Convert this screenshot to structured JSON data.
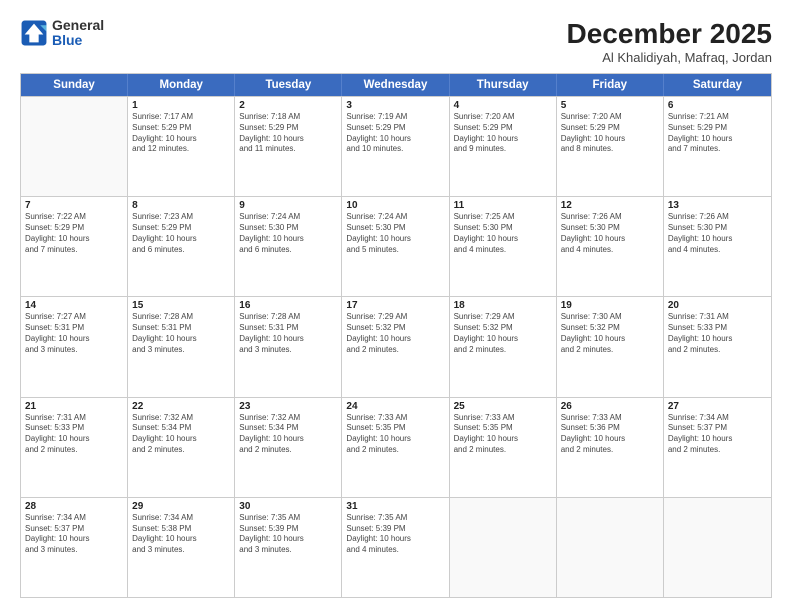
{
  "logo": {
    "line1": "General",
    "line2": "Blue"
  },
  "title": "December 2025",
  "location": "Al Khalidiyah, Mafraq, Jordan",
  "header_days": [
    "Sunday",
    "Monday",
    "Tuesday",
    "Wednesday",
    "Thursday",
    "Friday",
    "Saturday"
  ],
  "weeks": [
    [
      {
        "day": "",
        "info": ""
      },
      {
        "day": "1",
        "info": "Sunrise: 7:17 AM\nSunset: 5:29 PM\nDaylight: 10 hours\nand 12 minutes."
      },
      {
        "day": "2",
        "info": "Sunrise: 7:18 AM\nSunset: 5:29 PM\nDaylight: 10 hours\nand 11 minutes."
      },
      {
        "day": "3",
        "info": "Sunrise: 7:19 AM\nSunset: 5:29 PM\nDaylight: 10 hours\nand 10 minutes."
      },
      {
        "day": "4",
        "info": "Sunrise: 7:20 AM\nSunset: 5:29 PM\nDaylight: 10 hours\nand 9 minutes."
      },
      {
        "day": "5",
        "info": "Sunrise: 7:20 AM\nSunset: 5:29 PM\nDaylight: 10 hours\nand 8 minutes."
      },
      {
        "day": "6",
        "info": "Sunrise: 7:21 AM\nSunset: 5:29 PM\nDaylight: 10 hours\nand 7 minutes."
      }
    ],
    [
      {
        "day": "7",
        "info": "Sunrise: 7:22 AM\nSunset: 5:29 PM\nDaylight: 10 hours\nand 7 minutes."
      },
      {
        "day": "8",
        "info": "Sunrise: 7:23 AM\nSunset: 5:29 PM\nDaylight: 10 hours\nand 6 minutes."
      },
      {
        "day": "9",
        "info": "Sunrise: 7:24 AM\nSunset: 5:30 PM\nDaylight: 10 hours\nand 6 minutes."
      },
      {
        "day": "10",
        "info": "Sunrise: 7:24 AM\nSunset: 5:30 PM\nDaylight: 10 hours\nand 5 minutes."
      },
      {
        "day": "11",
        "info": "Sunrise: 7:25 AM\nSunset: 5:30 PM\nDaylight: 10 hours\nand 4 minutes."
      },
      {
        "day": "12",
        "info": "Sunrise: 7:26 AM\nSunset: 5:30 PM\nDaylight: 10 hours\nand 4 minutes."
      },
      {
        "day": "13",
        "info": "Sunrise: 7:26 AM\nSunset: 5:30 PM\nDaylight: 10 hours\nand 4 minutes."
      }
    ],
    [
      {
        "day": "14",
        "info": "Sunrise: 7:27 AM\nSunset: 5:31 PM\nDaylight: 10 hours\nand 3 minutes."
      },
      {
        "day": "15",
        "info": "Sunrise: 7:28 AM\nSunset: 5:31 PM\nDaylight: 10 hours\nand 3 minutes."
      },
      {
        "day": "16",
        "info": "Sunrise: 7:28 AM\nSunset: 5:31 PM\nDaylight: 10 hours\nand 3 minutes."
      },
      {
        "day": "17",
        "info": "Sunrise: 7:29 AM\nSunset: 5:32 PM\nDaylight: 10 hours\nand 2 minutes."
      },
      {
        "day": "18",
        "info": "Sunrise: 7:29 AM\nSunset: 5:32 PM\nDaylight: 10 hours\nand 2 minutes."
      },
      {
        "day": "19",
        "info": "Sunrise: 7:30 AM\nSunset: 5:32 PM\nDaylight: 10 hours\nand 2 minutes."
      },
      {
        "day": "20",
        "info": "Sunrise: 7:31 AM\nSunset: 5:33 PM\nDaylight: 10 hours\nand 2 minutes."
      }
    ],
    [
      {
        "day": "21",
        "info": "Sunrise: 7:31 AM\nSunset: 5:33 PM\nDaylight: 10 hours\nand 2 minutes."
      },
      {
        "day": "22",
        "info": "Sunrise: 7:32 AM\nSunset: 5:34 PM\nDaylight: 10 hours\nand 2 minutes."
      },
      {
        "day": "23",
        "info": "Sunrise: 7:32 AM\nSunset: 5:34 PM\nDaylight: 10 hours\nand 2 minutes."
      },
      {
        "day": "24",
        "info": "Sunrise: 7:33 AM\nSunset: 5:35 PM\nDaylight: 10 hours\nand 2 minutes."
      },
      {
        "day": "25",
        "info": "Sunrise: 7:33 AM\nSunset: 5:35 PM\nDaylight: 10 hours\nand 2 minutes."
      },
      {
        "day": "26",
        "info": "Sunrise: 7:33 AM\nSunset: 5:36 PM\nDaylight: 10 hours\nand 2 minutes."
      },
      {
        "day": "27",
        "info": "Sunrise: 7:34 AM\nSunset: 5:37 PM\nDaylight: 10 hours\nand 2 minutes."
      }
    ],
    [
      {
        "day": "28",
        "info": "Sunrise: 7:34 AM\nSunset: 5:37 PM\nDaylight: 10 hours\nand 3 minutes."
      },
      {
        "day": "29",
        "info": "Sunrise: 7:34 AM\nSunset: 5:38 PM\nDaylight: 10 hours\nand 3 minutes."
      },
      {
        "day": "30",
        "info": "Sunrise: 7:35 AM\nSunset: 5:39 PM\nDaylight: 10 hours\nand 3 minutes."
      },
      {
        "day": "31",
        "info": "Sunrise: 7:35 AM\nSunset: 5:39 PM\nDaylight: 10 hours\nand 4 minutes."
      },
      {
        "day": "",
        "info": ""
      },
      {
        "day": "",
        "info": ""
      },
      {
        "day": "",
        "info": ""
      }
    ]
  ]
}
